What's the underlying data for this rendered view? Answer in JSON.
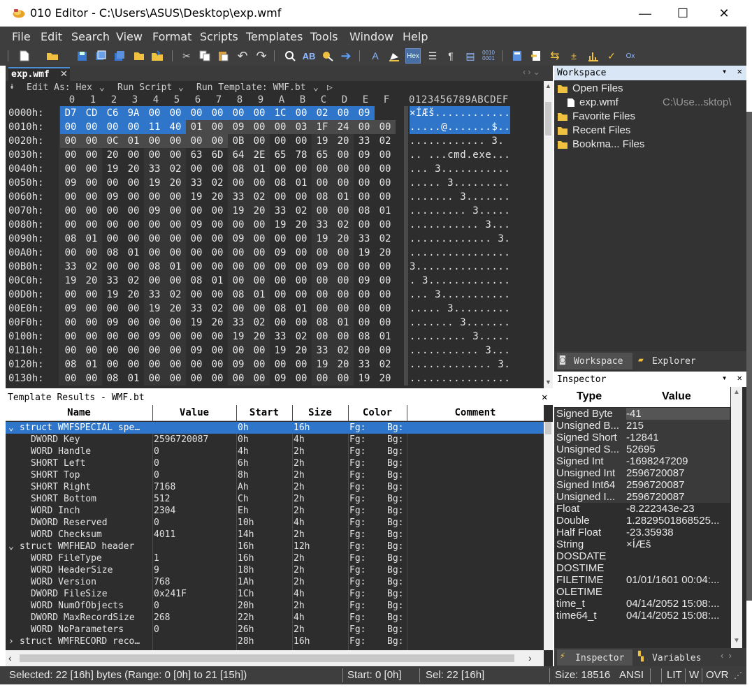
{
  "window": {
    "title": "010 Editor - C:\\Users\\ASUS\\Desktop\\exp.wmf",
    "minimize": "—",
    "maximize": "☐",
    "close": "✕"
  },
  "menu": [
    "File",
    "Edit",
    "Search",
    "View",
    "Format",
    "Scripts",
    "Templates",
    "Tools",
    "Window",
    "Help"
  ],
  "tab": {
    "label": "exp.wmf",
    "close": "✕"
  },
  "editbar": {
    "edit_as": "Edit As: Hex",
    "run_script": "Run Script",
    "run_template": "Run Template: WMF.bt"
  },
  "hex": {
    "columns": [
      "0",
      "1",
      "2",
      "3",
      "4",
      "5",
      "6",
      "7",
      "8",
      "9",
      "A",
      "B",
      "C",
      "D",
      "E",
      "F"
    ],
    "ascii_header": "0123456789ABCDEF",
    "rows": [
      {
        "addr": "0000h:",
        "bytes": [
          "D7",
          "CD",
          "C6",
          "9A",
          "00",
          "00",
          "00",
          "00",
          "00",
          "00",
          "1C",
          "00",
          "02",
          "00",
          "09"
        ],
        "ascii": "×ÍÆš............"
      },
      {
        "addr": "0010h:",
        "bytes": [
          "00",
          "00",
          "00",
          "00",
          "11",
          "40",
          "01",
          "00",
          "09",
          "00",
          "00",
          "03",
          "1F",
          "24",
          "00",
          "00"
        ],
        "ascii": ".....@.......$.."
      },
      {
        "addr": "0020h:",
        "bytes": [
          "00",
          "00",
          "0C",
          "01",
          "00",
          "00",
          "00",
          "00",
          "0B",
          "00",
          "00",
          "00",
          "19",
          "20",
          "33",
          "02"
        ],
        "ascii": "............ 3."
      },
      {
        "addr": "0030h:",
        "bytes": [
          "00",
          "00",
          "20",
          "00",
          "00",
          "00",
          "63",
          "6D",
          "64",
          "2E",
          "65",
          "78",
          "65",
          "00",
          "09",
          "00"
        ],
        "ascii": ".. ...cmd.exe..."
      },
      {
        "addr": "0040h:",
        "bytes": [
          "00",
          "00",
          "19",
          "20",
          "33",
          "02",
          "00",
          "00",
          "08",
          "01",
          "00",
          "00",
          "00",
          "00",
          "00",
          "00"
        ],
        "ascii": "... 3..........."
      },
      {
        "addr": "0050h:",
        "bytes": [
          "09",
          "00",
          "00",
          "00",
          "19",
          "20",
          "33",
          "02",
          "00",
          "00",
          "08",
          "01",
          "00",
          "00",
          "00",
          "00"
        ],
        "ascii": "..... 3........."
      },
      {
        "addr": "0060h:",
        "bytes": [
          "00",
          "00",
          "09",
          "00",
          "00",
          "00",
          "19",
          "20",
          "33",
          "02",
          "00",
          "00",
          "08",
          "01",
          "00",
          "00"
        ],
        "ascii": "....... 3......."
      },
      {
        "addr": "0070h:",
        "bytes": [
          "00",
          "00",
          "00",
          "00",
          "09",
          "00",
          "00",
          "00",
          "19",
          "20",
          "33",
          "02",
          "00",
          "00",
          "08",
          "01"
        ],
        "ascii": "......... 3....."
      },
      {
        "addr": "0080h:",
        "bytes": [
          "00",
          "00",
          "00",
          "00",
          "00",
          "00",
          "09",
          "00",
          "00",
          "00",
          "19",
          "20",
          "33",
          "02",
          "00",
          "00"
        ],
        "ascii": "........... 3..."
      },
      {
        "addr": "0090h:",
        "bytes": [
          "08",
          "01",
          "00",
          "00",
          "00",
          "00",
          "00",
          "00",
          "09",
          "00",
          "00",
          "00",
          "19",
          "20",
          "33",
          "02"
        ],
        "ascii": "............. 3."
      },
      {
        "addr": "00A0h:",
        "bytes": [
          "00",
          "00",
          "08",
          "01",
          "00",
          "00",
          "00",
          "00",
          "00",
          "00",
          "09",
          "00",
          "00",
          "00",
          "19",
          "20"
        ],
        "ascii": "................"
      },
      {
        "addr": "00B0h:",
        "bytes": [
          "33",
          "02",
          "00",
          "00",
          "08",
          "01",
          "00",
          "00",
          "00",
          "00",
          "00",
          "00",
          "09",
          "00",
          "00",
          "00"
        ],
        "ascii": "3..............."
      },
      {
        "addr": "00C0h:",
        "bytes": [
          "19",
          "20",
          "33",
          "02",
          "00",
          "00",
          "08",
          "01",
          "00",
          "00",
          "00",
          "00",
          "00",
          "00",
          "09",
          "00"
        ],
        "ascii": ". 3............."
      },
      {
        "addr": "00D0h:",
        "bytes": [
          "00",
          "00",
          "19",
          "20",
          "33",
          "02",
          "00",
          "00",
          "08",
          "01",
          "00",
          "00",
          "00",
          "00",
          "00",
          "00"
        ],
        "ascii": "... 3..........."
      },
      {
        "addr": "00E0h:",
        "bytes": [
          "09",
          "00",
          "00",
          "00",
          "19",
          "20",
          "33",
          "02",
          "00",
          "00",
          "08",
          "01",
          "00",
          "00",
          "00",
          "00"
        ],
        "ascii": "..... 3........."
      },
      {
        "addr": "00F0h:",
        "bytes": [
          "00",
          "00",
          "09",
          "00",
          "00",
          "00",
          "19",
          "20",
          "33",
          "02",
          "00",
          "00",
          "08",
          "01",
          "00",
          "00"
        ],
        "ascii": "....... 3......."
      },
      {
        "addr": "0100h:",
        "bytes": [
          "00",
          "00",
          "00",
          "00",
          "09",
          "00",
          "00",
          "00",
          "19",
          "20",
          "33",
          "02",
          "00",
          "00",
          "08",
          "01"
        ],
        "ascii": "......... 3....."
      },
      {
        "addr": "0110h:",
        "bytes": [
          "00",
          "00",
          "00",
          "00",
          "00",
          "00",
          "09",
          "00",
          "00",
          "00",
          "19",
          "20",
          "33",
          "02",
          "00",
          "00"
        ],
        "ascii": "........... 3..."
      },
      {
        "addr": "0120h:",
        "bytes": [
          "08",
          "01",
          "00",
          "00",
          "00",
          "00",
          "00",
          "00",
          "09",
          "00",
          "00",
          "00",
          "19",
          "20",
          "33",
          "02"
        ],
        "ascii": "............. 3."
      },
      {
        "addr": "0130h:",
        "bytes": [
          "00",
          "00",
          "08",
          "01",
          "00",
          "00",
          "00",
          "00",
          "00",
          "00",
          "09",
          "00",
          "00",
          "00",
          "19",
          "20"
        ],
        "ascii": "................"
      }
    ]
  },
  "template": {
    "title": "Template Results - WMF.bt",
    "columns": [
      "Name",
      "Value",
      "Start",
      "Size",
      "Color",
      "Comment"
    ],
    "rows": [
      {
        "name": "struct WMFSPECIAL spe…",
        "value": "",
        "start": "0h",
        "size": "16h",
        "fg": "Fg:",
        "bg": "Bg:",
        "level": 0,
        "expander": "⌄",
        "selected": true
      },
      {
        "name": "DWORD Key",
        "value": "2596720087",
        "start": "0h",
        "size": "4h",
        "fg": "Fg:",
        "bg": "Bg:",
        "level": 1
      },
      {
        "name": "WORD Handle",
        "value": "0",
        "start": "4h",
        "size": "2h",
        "fg": "Fg:",
        "bg": "Bg:",
        "level": 1
      },
      {
        "name": "SHORT Left",
        "value": "0",
        "start": "6h",
        "size": "2h",
        "fg": "Fg:",
        "bg": "Bg:",
        "level": 1
      },
      {
        "name": "SHORT Top",
        "value": "0",
        "start": "8h",
        "size": "2h",
        "fg": "Fg:",
        "bg": "Bg:",
        "level": 1
      },
      {
        "name": "SHORT Right",
        "value": "7168",
        "start": "Ah",
        "size": "2h",
        "fg": "Fg:",
        "bg": "Bg:",
        "level": 1
      },
      {
        "name": "SHORT Bottom",
        "value": "512",
        "start": "Ch",
        "size": "2h",
        "fg": "Fg:",
        "bg": "Bg:",
        "level": 1
      },
      {
        "name": "WORD Inch",
        "value": "2304",
        "start": "Eh",
        "size": "2h",
        "fg": "Fg:",
        "bg": "Bg:",
        "level": 1
      },
      {
        "name": "DWORD Reserved",
        "value": "0",
        "start": "10h",
        "size": "4h",
        "fg": "Fg:",
        "bg": "Bg:",
        "level": 1
      },
      {
        "name": "WORD Checksum",
        "value": "4011",
        "start": "14h",
        "size": "2h",
        "fg": "Fg:",
        "bg": "Bg:",
        "level": 1
      },
      {
        "name": "struct WMFHEAD header",
        "value": "",
        "start": "16h",
        "size": "12h",
        "fg": "Fg:",
        "bg": "Bg:",
        "level": 0,
        "expander": "⌄"
      },
      {
        "name": "WORD FileType",
        "value": "1",
        "start": "16h",
        "size": "2h",
        "fg": "Fg:",
        "bg": "Bg:",
        "level": 1
      },
      {
        "name": "WORD HeaderSize",
        "value": "9",
        "start": "18h",
        "size": "2h",
        "fg": "Fg:",
        "bg": "Bg:",
        "level": 1
      },
      {
        "name": "WORD Version",
        "value": "768",
        "start": "1Ah",
        "size": "2h",
        "fg": "Fg:",
        "bg": "Bg:",
        "level": 1
      },
      {
        "name": "DWORD FileSize",
        "value": "0x241F",
        "start": "1Ch",
        "size": "4h",
        "fg": "Fg:",
        "bg": "Bg:",
        "level": 1
      },
      {
        "name": "WORD NumOfObjects",
        "value": "0",
        "start": "20h",
        "size": "2h",
        "fg": "Fg:",
        "bg": "Bg:",
        "level": 1
      },
      {
        "name": "DWORD MaxRecordSize",
        "value": "268",
        "start": "22h",
        "size": "4h",
        "fg": "Fg:",
        "bg": "Bg:",
        "level": 1
      },
      {
        "name": "WORD NoParameters",
        "value": "0",
        "start": "26h",
        "size": "2h",
        "fg": "Fg:",
        "bg": "Bg:",
        "level": 1
      },
      {
        "name": "struct WMFRECORD reco…",
        "value": "",
        "start": "28h",
        "size": "16h",
        "fg": "Fg:",
        "bg": "Bg:",
        "level": 0,
        "expander": "›"
      }
    ]
  },
  "workspace": {
    "title": "Workspace",
    "items": [
      {
        "label": "Open Files",
        "icon": "folder-open-icon",
        "level": 0
      },
      {
        "label": "exp.wmf",
        "icon": "file-icon",
        "level": 1,
        "path": "C:\\Use...sktop\\"
      },
      {
        "label": "Favorite Files",
        "icon": "favorite-folder-icon",
        "level": 0
      },
      {
        "label": "Recent Files",
        "icon": "recent-folder-icon",
        "level": 0
      },
      {
        "label": "Bookma... Files",
        "icon": "bookmark-folder-icon",
        "level": 0
      }
    ],
    "tabs": [
      "Workspace",
      "Explorer"
    ]
  },
  "inspector": {
    "title": "Inspector",
    "columns": [
      "Type",
      "Value"
    ],
    "rows": [
      {
        "type": "Signed Byte",
        "value": "-41"
      },
      {
        "type": "Unsigned B...",
        "value": "215"
      },
      {
        "type": "Signed Short",
        "value": "-12841"
      },
      {
        "type": "Unsigned S...",
        "value": "52695"
      },
      {
        "type": "Signed Int",
        "value": "-1698247209"
      },
      {
        "type": "Unsigned Int",
        "value": "2596720087"
      },
      {
        "type": "Signed Int64",
        "value": "2596720087"
      },
      {
        "type": "Unsigned I...",
        "value": "2596720087"
      },
      {
        "type": "Float",
        "value": "-8.222343e-23"
      },
      {
        "type": "Double",
        "value": "1.2829501868525..."
      },
      {
        "type": "Half Float",
        "value": "-23.35938"
      },
      {
        "type": "String",
        "value": "×ÍÆš"
      },
      {
        "type": "DOSDATE",
        "value": ""
      },
      {
        "type": "DOSTIME",
        "value": ""
      },
      {
        "type": "FILETIME",
        "value": "01/01/1601 00:04:..."
      },
      {
        "type": "OLETIME",
        "value": ""
      },
      {
        "type": "time_t",
        "value": "04/14/2052 15:08:..."
      },
      {
        "type": "time64_t",
        "value": "04/14/2052 15:08:..."
      }
    ],
    "tabs": [
      "Inspector",
      "Variables"
    ]
  },
  "status": {
    "selected": "Selected: 22 [16h] bytes (Range: 0 [0h] to 21 [15h])",
    "start": "Start: 0 [0h]",
    "sel": "Sel: 22 [16h]",
    "size": "Size: 18516",
    "encoding": "ANSI",
    "lit": "LIT",
    "w": "W",
    "ovr": "OVR"
  },
  "colors": {
    "selection": "#2f75c9",
    "panel_bg": "#2d2d2d",
    "chrome_bg": "#3e3e3e",
    "workspace_header": "#d9e6f5"
  }
}
